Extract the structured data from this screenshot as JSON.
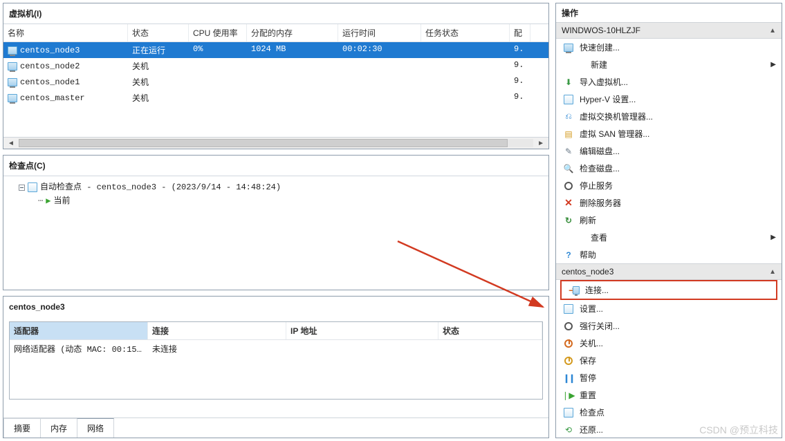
{
  "vm_panel": {
    "title": "虚拟机(I)",
    "columns": {
      "name": "名称",
      "status": "状态",
      "cpu": "CPU 使用率",
      "mem": "分配的内存",
      "uptime": "运行时间",
      "task": "任务状态",
      "ver": "配"
    },
    "rows": [
      {
        "name": "centos_node3",
        "status": "正在运行",
        "cpu": "0%",
        "mem": "1024 MB",
        "uptime": "00:02:30",
        "task": "",
        "ver": "9.",
        "selected": true
      },
      {
        "name": "centos_node2",
        "status": "关机",
        "cpu": "",
        "mem": "",
        "uptime": "",
        "task": "",
        "ver": "9.",
        "selected": false
      },
      {
        "name": "centos_node1",
        "status": "关机",
        "cpu": "",
        "mem": "",
        "uptime": "",
        "task": "",
        "ver": "9.",
        "selected": false
      },
      {
        "name": "centos_master",
        "status": "关机",
        "cpu": "",
        "mem": "",
        "uptime": "",
        "task": "",
        "ver": "9.",
        "selected": false
      }
    ]
  },
  "checkpoints": {
    "title": "检查点(C)",
    "root": "自动检查点 - centos_node3 - (2023/9/14 - 14:48:24)",
    "child": "当前"
  },
  "details": {
    "title": "centos_node3",
    "columns": {
      "adapter": "适配器",
      "conn": "连接",
      "ip": "IP 地址",
      "status": "状态"
    },
    "rows": [
      {
        "adapter": "网络适配器 (动态 MAC: 00:15:5...",
        "conn": "未连接",
        "ip": "",
        "status": ""
      }
    ],
    "tabs": [
      "摘要",
      "内存",
      "网络"
    ],
    "active_tab": 2
  },
  "actions": {
    "title": "操作",
    "host_header": "WINDWOS-10HLZJF",
    "vm_header": "centos_node3",
    "host_items": [
      {
        "label": "快速创建...",
        "icon": "monitor-icon"
      },
      {
        "label": "新建",
        "icon": "blank-icon",
        "submenu": true
      },
      {
        "label": "导入虚拟机...",
        "icon": "import-icon"
      },
      {
        "label": "Hyper-V 设置...",
        "icon": "settings-icon"
      },
      {
        "label": "虚拟交换机管理器...",
        "icon": "switch-icon"
      },
      {
        "label": "虚拟 SAN 管理器...",
        "icon": "san-icon"
      },
      {
        "label": "编辑磁盘...",
        "icon": "disk-edit-icon"
      },
      {
        "label": "检查磁盘...",
        "icon": "disk-check-icon"
      },
      {
        "label": "停止服务",
        "icon": "stop-icon"
      },
      {
        "label": "删除服务器",
        "icon": "delete-icon"
      },
      {
        "label": "刷新",
        "icon": "refresh-icon"
      },
      {
        "label": "查看",
        "icon": "blank-icon",
        "submenu": true
      },
      {
        "label": "帮助",
        "icon": "help-icon"
      }
    ],
    "vm_items": [
      {
        "label": "连接...",
        "icon": "connect-icon",
        "highlight": true
      },
      {
        "label": "设置...",
        "icon": "settings-icon"
      },
      {
        "label": "强行关闭...",
        "icon": "force-off-icon"
      },
      {
        "label": "关机...",
        "icon": "shutdown-icon"
      },
      {
        "label": "保存",
        "icon": "save-icon"
      },
      {
        "label": "暂停",
        "icon": "pause-icon"
      },
      {
        "label": "重置",
        "icon": "reset-icon"
      },
      {
        "label": "检查点",
        "icon": "checkpoint-icon"
      },
      {
        "label": "还原...",
        "icon": "revert-icon"
      }
    ]
  },
  "watermark": "CSDN @预立科技"
}
